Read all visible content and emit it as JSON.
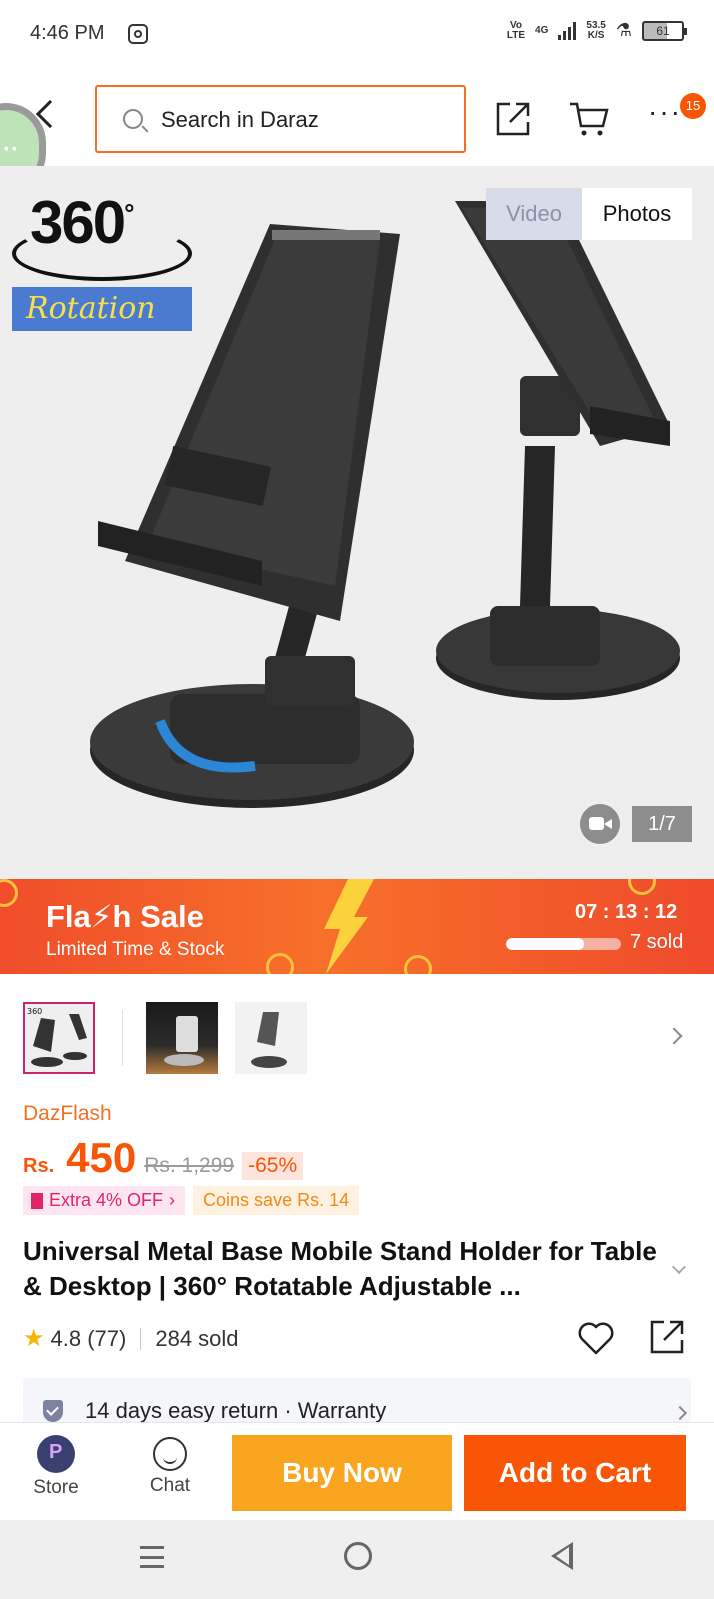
{
  "status_bar": {
    "time": "4:46 PM",
    "network_top": "Vo",
    "network_bottom": "LTE",
    "signal_label": "4G",
    "speed_top": "53.5",
    "speed_bottom": "K/S",
    "battery": "61"
  },
  "header": {
    "search_placeholder": "Search in Daraz",
    "cart_badge": "15"
  },
  "hero": {
    "badge_number": "360",
    "badge_degree": "°",
    "badge_word": "Rotation",
    "toggle_video": "Video",
    "toggle_photos": "Photos",
    "counter": "1/7"
  },
  "flash_sale": {
    "title": "Fla⚡h Sale",
    "subtitle": "Limited Time & Stock",
    "timer": "07 : 13 : 12",
    "sold": "7 sold",
    "progress": 0.68
  },
  "product": {
    "label": "DazFlash",
    "currency": "Rs.",
    "price": "450",
    "old_price": "Rs. 1,299",
    "discount": "-65%",
    "promo_extra": "Extra 4% OFF",
    "promo_extra_arrow": "›",
    "promo_coins": "Coins save Rs. 14",
    "title": "Universal Metal Base Mobile Stand Holder for Table & Desktop | 360° Rotatable Adjustable ...",
    "rating": "4.8 (77)",
    "sold": "284 sold",
    "star": "★"
  },
  "service": {
    "text": "14 days easy return  ·  Warranty"
  },
  "bottom_bar": {
    "store_label": "Store",
    "chat_label": "Chat",
    "buy_now": "Buy Now",
    "add_to_cart": "Add to Cart"
  },
  "colors": {
    "brand_orange": "#f85606",
    "buy_now_yellow": "#f9a51f",
    "search_border": "#f36f22"
  }
}
